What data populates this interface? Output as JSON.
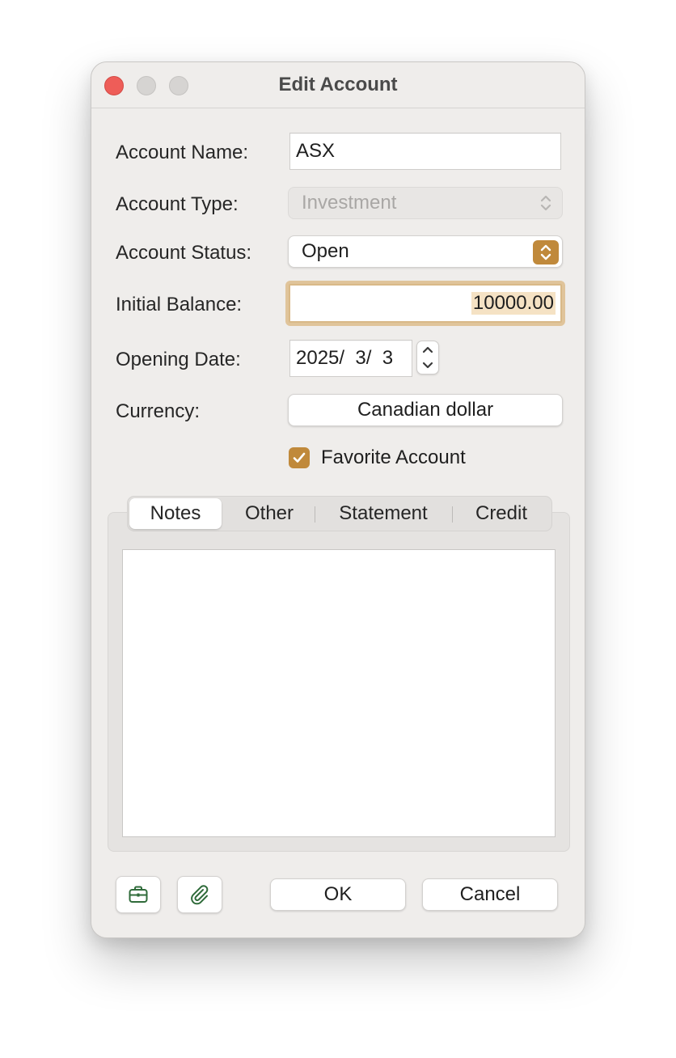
{
  "window": {
    "title": "Edit Account"
  },
  "form": {
    "account_name": {
      "label": "Account Name:",
      "value": "ASX"
    },
    "account_type": {
      "label": "Account Type:",
      "value": "Investment"
    },
    "account_status": {
      "label": "Account Status:",
      "value": "Open"
    },
    "initial_balance": {
      "label": "Initial Balance:",
      "value": "10000.00"
    },
    "opening_date": {
      "label": "Opening Date:",
      "value": "2025/  3/  3"
    },
    "currency": {
      "label": "Currency:",
      "value": "Canadian dollar"
    },
    "favorite": {
      "label": "Favorite Account",
      "checked": true
    }
  },
  "tabs": [
    {
      "label": "Notes",
      "selected": true
    },
    {
      "label": "Other",
      "selected": false
    },
    {
      "label": "Statement",
      "selected": false
    },
    {
      "label": "Credit",
      "selected": false
    }
  ],
  "notes": {
    "value": ""
  },
  "footer": {
    "left_icons": [
      "briefcase-icon",
      "paperclip-icon"
    ],
    "ok_label": "OK",
    "cancel_label": "Cancel"
  },
  "colors": {
    "accent": "#c0893b",
    "close": "#ee5d58",
    "icon_green": "#2f6b3a"
  }
}
